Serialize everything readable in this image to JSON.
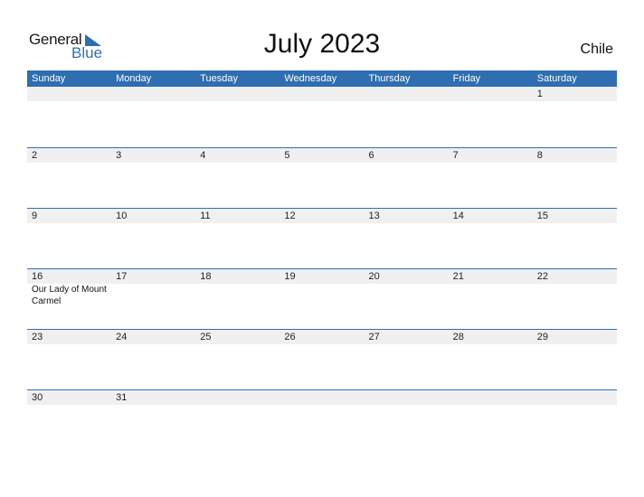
{
  "logo": {
    "word1": "General",
    "word2": "Blue"
  },
  "title": "July 2023",
  "country": "Chile",
  "colors": {
    "header_bg": "#2f6eb0",
    "band_bg": "#f0f0f0",
    "logo_blue": "#2e6fb3"
  },
  "weekdays": [
    "Sunday",
    "Monday",
    "Tuesday",
    "Wednesday",
    "Thursday",
    "Friday",
    "Saturday"
  ],
  "weeks": [
    [
      {
        "d": ""
      },
      {
        "d": ""
      },
      {
        "d": ""
      },
      {
        "d": ""
      },
      {
        "d": ""
      },
      {
        "d": ""
      },
      {
        "d": "1"
      }
    ],
    [
      {
        "d": "2"
      },
      {
        "d": "3"
      },
      {
        "d": "4"
      },
      {
        "d": "5"
      },
      {
        "d": "6"
      },
      {
        "d": "7"
      },
      {
        "d": "8"
      }
    ],
    [
      {
        "d": "9"
      },
      {
        "d": "10"
      },
      {
        "d": "11"
      },
      {
        "d": "12"
      },
      {
        "d": "13"
      },
      {
        "d": "14"
      },
      {
        "d": "15"
      }
    ],
    [
      {
        "d": "16",
        "e": "Our Lady of Mount Carmel"
      },
      {
        "d": "17"
      },
      {
        "d": "18"
      },
      {
        "d": "19"
      },
      {
        "d": "20"
      },
      {
        "d": "21"
      },
      {
        "d": "22"
      }
    ],
    [
      {
        "d": "23"
      },
      {
        "d": "24"
      },
      {
        "d": "25"
      },
      {
        "d": "26"
      },
      {
        "d": "27"
      },
      {
        "d": "28"
      },
      {
        "d": "29"
      }
    ],
    [
      {
        "d": "30"
      },
      {
        "d": "31"
      },
      {
        "d": ""
      },
      {
        "d": ""
      },
      {
        "d": ""
      },
      {
        "d": ""
      },
      {
        "d": ""
      }
    ]
  ]
}
